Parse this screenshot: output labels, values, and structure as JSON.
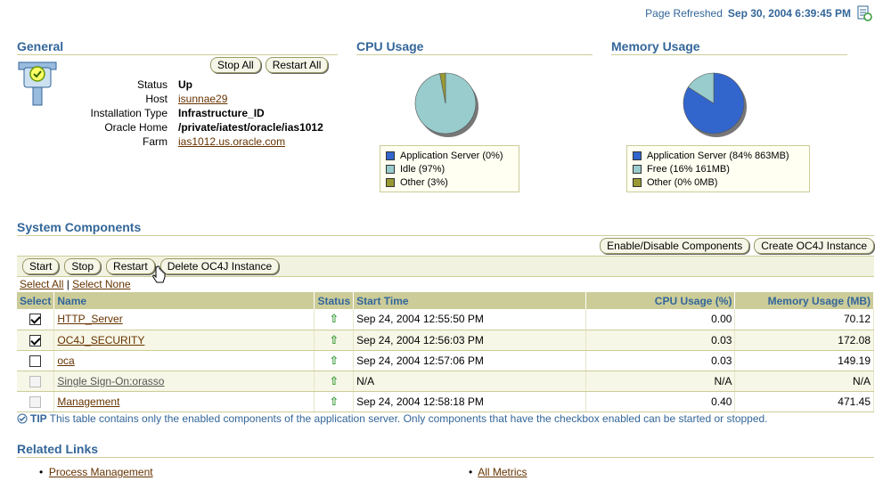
{
  "refresh": {
    "label": "Page Refreshed",
    "timestamp": "Sep 30, 2004 6:39:45 PM"
  },
  "general": {
    "title": "General",
    "buttons": {
      "stop_all": "Stop All",
      "restart_all": "Restart All"
    },
    "fields": {
      "status_label": "Status",
      "status_value": "Up",
      "host_label": "Host",
      "host_value": "isunnae29",
      "install_label": "Installation Type",
      "install_value": "Infrastructure_ID",
      "home_label": "Oracle Home",
      "home_value": "/private/iatest/oracle/ias1012",
      "farm_label": "Farm",
      "farm_value": "ias1012.us.oracle.com"
    }
  },
  "cpu": {
    "title": "CPU Usage",
    "legend": [
      "Application Server (0%)",
      "Idle (97%)",
      "Other (3%)"
    ],
    "colors": [
      "#3366cc",
      "#99cccc",
      "#999933"
    ],
    "slices": [
      0,
      97,
      3
    ]
  },
  "memory": {
    "title": "Memory Usage",
    "legend": [
      "Application Server (84% 863MB)",
      "Free (16% 161MB)",
      "Other (0% 0MB)"
    ],
    "colors": [
      "#3366cc",
      "#99cccc",
      "#999933"
    ],
    "slices": [
      84,
      16,
      0
    ]
  },
  "components": {
    "title": "System Components",
    "top_buttons": {
      "enable_disable": "Enable/Disable Components",
      "create_oc4j": "Create OC4J Instance"
    },
    "toolbar": {
      "start": "Start",
      "stop": "Stop",
      "restart": "Restart",
      "delete_oc4j": "Delete OC4J Instance"
    },
    "select_all": "Select All",
    "select_none": "Select None",
    "separator": "|",
    "columns": {
      "select": "Select",
      "name": "Name",
      "status": "Status",
      "start_time": "Start Time",
      "cpu": "CPU Usage (%)",
      "memory": "Memory Usage (MB)"
    },
    "rows": [
      {
        "name": "HTTP_Server",
        "status_icon": "up-arrow-icon",
        "start_time": "Sep 24, 2004 12:55:50 PM",
        "cpu": "0.00",
        "memory": "70.12",
        "checked": true,
        "enabled": true
      },
      {
        "name": "OC4J_SECURITY",
        "status_icon": "up-arrow-icon",
        "start_time": "Sep 24, 2004 12:56:03 PM",
        "cpu": "0.03",
        "memory": "172.08",
        "checked": true,
        "enabled": true
      },
      {
        "name": "oca",
        "status_icon": "up-arrow-icon",
        "start_time": "Sep 24, 2004 12:57:06 PM",
        "cpu": "0.03",
        "memory": "149.19",
        "checked": false,
        "enabled": true
      },
      {
        "name": "Single Sign-On:orasso",
        "status_icon": "up-arrow-icon",
        "start_time": "N/A",
        "cpu": "N/A",
        "memory": "N/A",
        "checked": false,
        "enabled": false
      },
      {
        "name": "Management",
        "status_icon": "up-arrow-icon",
        "start_time": "Sep 24, 2004 12:58:18 PM",
        "cpu": "0.40",
        "memory": "471.45",
        "checked": false,
        "enabled": false
      }
    ],
    "up_glyph": "⇧",
    "tip_label": "TIP",
    "tip_text": "This table contains only the enabled components of the application server. Only components that have the checkbox enabled can be started or stopped."
  },
  "related": {
    "title": "Related Links",
    "links": [
      "Process Management",
      "All Metrics"
    ]
  }
}
